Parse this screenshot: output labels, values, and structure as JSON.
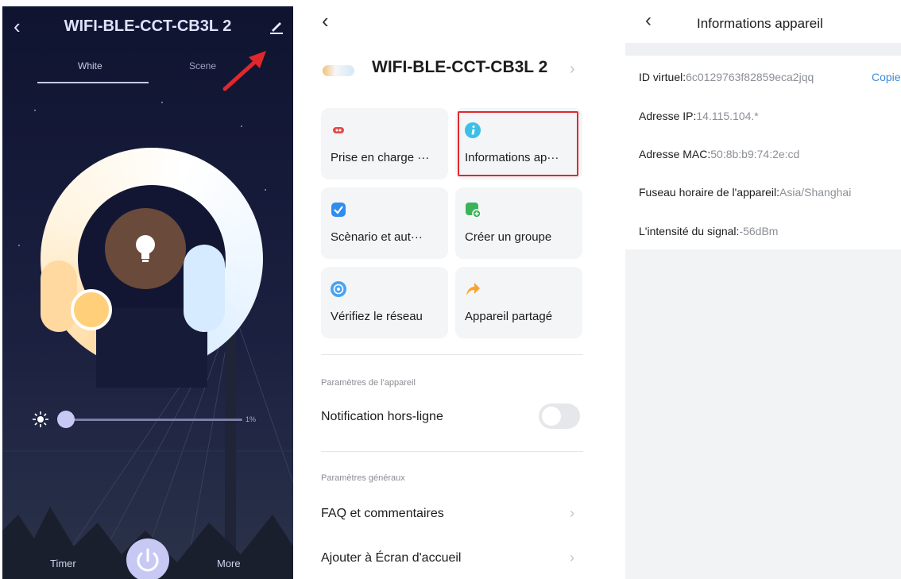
{
  "panel_control": {
    "title": "WIFI-BLE-CCT-CB3L 2",
    "tabs": [
      {
        "label": "White"
      },
      {
        "label": "Scene"
      }
    ],
    "brightness": {
      "value_label": "1%",
      "level": 0.01
    },
    "timer_label": "Timer",
    "more_label": "More"
  },
  "panel_settings": {
    "device_name": "WIFI-BLE-CCT-CB3L 2",
    "cards": [
      {
        "label": "Prise en charge ···",
        "icon": "support-icon"
      },
      {
        "label": "Informations ap···",
        "icon": "info-icon"
      },
      {
        "label": "Scènario et aut···",
        "icon": "automation-check-icon"
      },
      {
        "label": "Créer un groupe",
        "icon": "add-group-icon"
      },
      {
        "label": "Vérifiez le réseau",
        "icon": "network-icon"
      },
      {
        "label": "Appareil partagé",
        "icon": "share-icon"
      }
    ],
    "device_section_title": "Paramètres de l'appareil",
    "offline_notification_label": "Notification hors-ligne",
    "general_section_title": "Paramètres généraux",
    "faq_label": "FAQ et commentaires",
    "home_screen_label": "Ajouter à Écran d'accueil"
  },
  "panel_info": {
    "title": "Informations appareil",
    "virtual_id": {
      "label": "ID virtuel:",
      "value": "6c0129763f82859eca2jqq"
    },
    "copy_label": "Copie",
    "ip": {
      "label": "Adresse IP:",
      "value": "14.115.104.*"
    },
    "mac": {
      "label": "Adresse MAC:",
      "value": "50:8b:b9:74:2e:cd"
    },
    "timezone": {
      "label": "Fuseau horaire de l'appareil:",
      "value": "Asia/Shanghai"
    },
    "signal": {
      "label": "L'intensité du signal:",
      "value": "-56dBm"
    }
  },
  "colors": {
    "highlight_box": "#e0282c",
    "annotation_arrow": "#e0282c",
    "link": "#3b8bd8",
    "night_bg": "#161b3a"
  }
}
